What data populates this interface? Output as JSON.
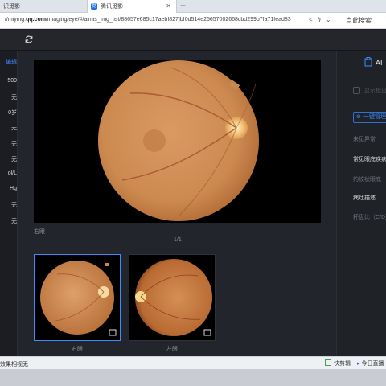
{
  "browser": {
    "tab1_label": "识觅影",
    "tab2_label": "腾讯觅影",
    "tab_icon": "觅",
    "new_tab": "+",
    "url_prefix": "//miying.",
    "url_domain": "qq.com",
    "url_rest": "/imaging/eye/#/aimis_img_list/88657e685c17aebf827fbf0d514e25657002668cbd299b7fa71fead83",
    "search_label": "点此搜索"
  },
  "left_list": [
    "编辑",
    "509",
    "无",
    "0岁",
    "无",
    "无",
    "无",
    "ol/L",
    "Hg",
    "无",
    "无"
  ],
  "viewer": {
    "caption": "右眼",
    "pager": "1/1"
  },
  "thumbnails": [
    {
      "label": "右眼",
      "selected": true
    },
    {
      "label": "左眼",
      "selected": false
    }
  ],
  "right_panel": {
    "tab_label": "AI",
    "checkbox_label": "显示检出",
    "button_label": "一键管理",
    "items": [
      "未见异常",
      "常见眼底疾病",
      "豹纹状眼底",
      "病灶描述",
      "杯盘比（C/D）"
    ]
  },
  "status": {
    "left_text": "效果相视无",
    "right1": "快剪辑",
    "right2": "今日直播"
  },
  "colors": {
    "accent": "#3d8bff",
    "fundus": "#c9874e"
  }
}
